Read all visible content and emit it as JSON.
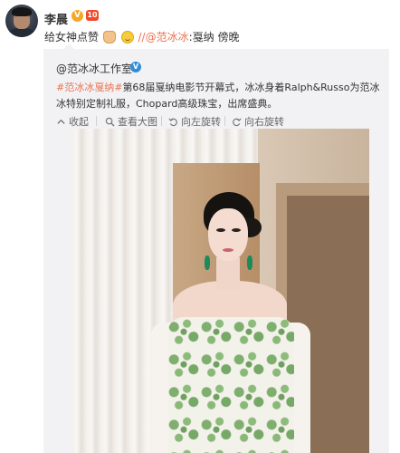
{
  "post": {
    "username": "李晨",
    "v_badge": "V",
    "vip_badge": "10",
    "text_prefix": "给女神点赞",
    "mention": "//@范冰冰",
    "text_suffix": ":戛纳 傍晚"
  },
  "repost": {
    "author": "@范冰冰工作室",
    "v_badge": "V",
    "hashtag": "#范冰冰戛纳#",
    "body": "第68届戛纳电影节开幕式，冰冰身着Ralph&Russo为范冰冰特别定制礼服，Chopard高级珠宝，出席盛典。",
    "toolbar": {
      "collapse": "收起",
      "view_large": "查看大图",
      "rotate_left": "向左旋转",
      "rotate_right": "向右旋转"
    }
  },
  "icons": {
    "collapse": "collapse-icon",
    "view_large": "magnifier-icon",
    "rotate_left": "rotate-left-icon",
    "rotate_right": "rotate-right-icon"
  },
  "colors": {
    "link": "#eb7350",
    "repost_bg": "#f2f2f5",
    "v_badge": "#f7a823",
    "verified_blue": "#2f8ed9"
  }
}
